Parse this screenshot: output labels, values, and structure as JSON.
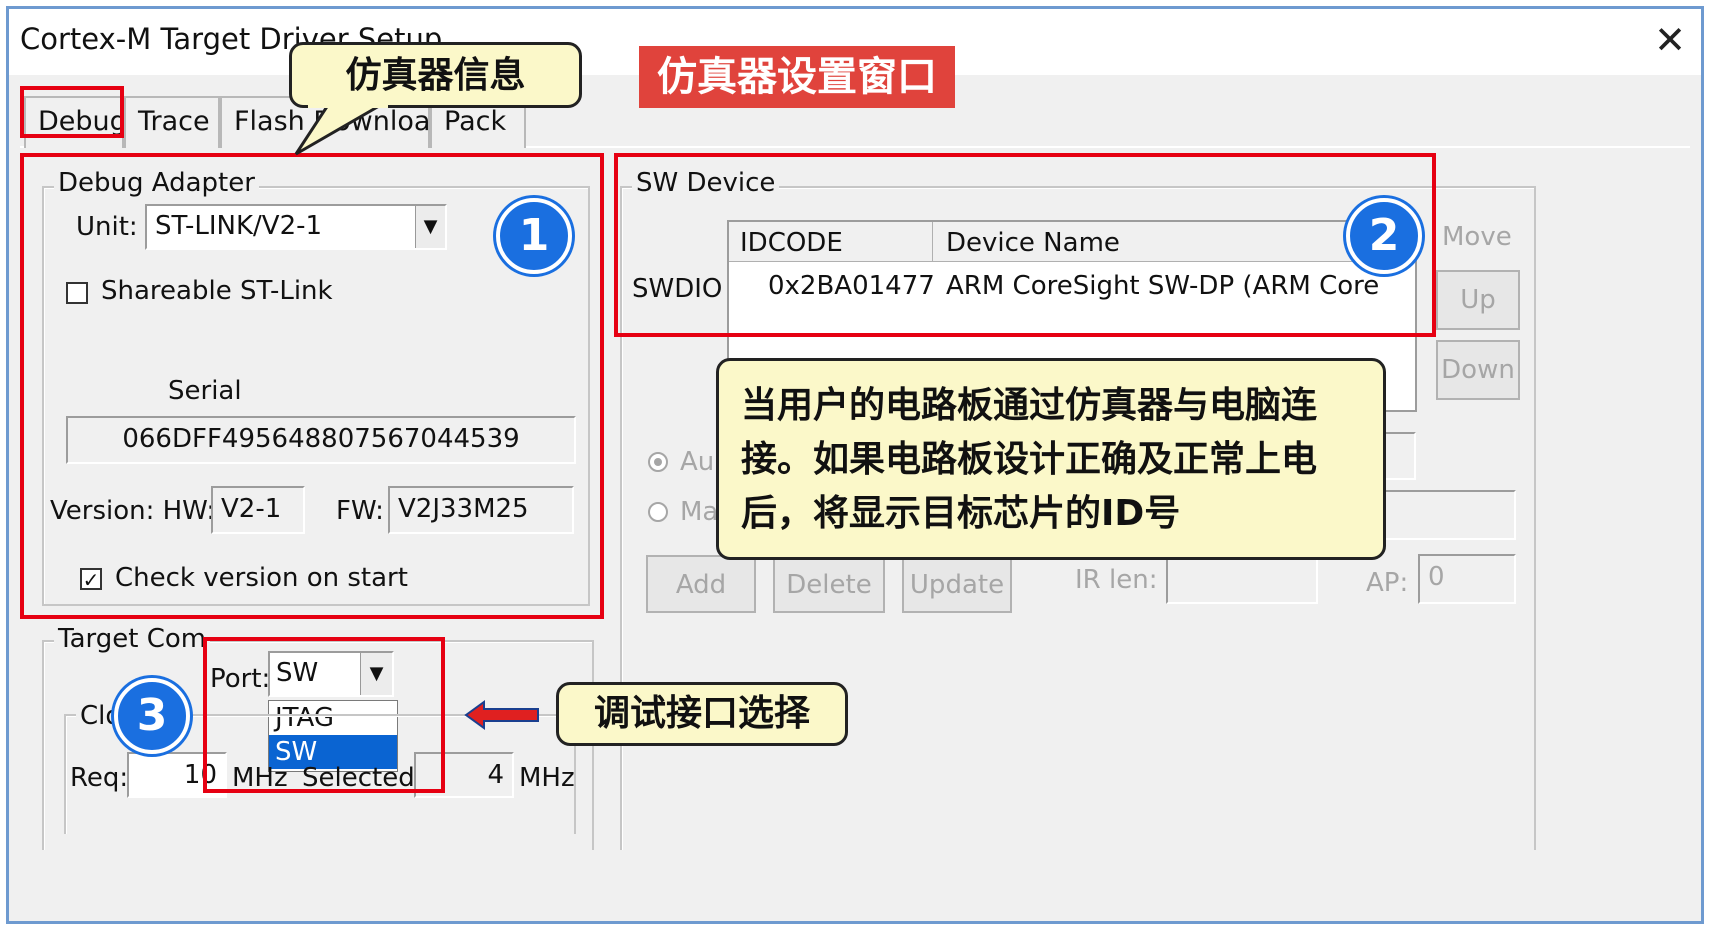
{
  "window": {
    "title": "Cortex-M Target Driver Setup"
  },
  "tabs": [
    {
      "label": "Debug"
    },
    {
      "label": "Trace"
    },
    {
      "label": "Flash Download"
    },
    {
      "label": "Pack"
    }
  ],
  "debug_adapter": {
    "legend": "Debug Adapter",
    "unit_label": "Unit:",
    "unit_value": "ST-LINK/V2-1",
    "shareable_label": "Shareable ST-Link",
    "serial_label": "Serial",
    "serial_value": "066DFF495648807567044539",
    "version_label": "Version: HW:",
    "hw_value": "V2-1",
    "fw_label": "FW:",
    "fw_value": "V2J33M25",
    "check_version_label": "Check version on start",
    "check_mark": "✓"
  },
  "target_com": {
    "legend": "Target Com",
    "port_label": "Port:",
    "port_value": "SW",
    "port_options": [
      "JTAG",
      "SW"
    ],
    "clock_legend": "Clo",
    "req_label": "Req:",
    "req_value": "10",
    "mhz": "MHz",
    "selected_label": "Selected:",
    "selected_value": "4",
    "selected_mhz": "MHz"
  },
  "sw_device": {
    "legend": "SW Device",
    "row_label": "SWDIO",
    "col_idcode": "IDCODE",
    "col_device_name": "Device Name",
    "idcode_value": "0x2BA01477",
    "device_name_value": "ARM CoreSight SW-DP (ARM Core",
    "move_label": "Move",
    "up_label": "Up",
    "down_label": "Down",
    "radio_auto": "Au",
    "radio_manual": "Ma",
    "add_label": "Add",
    "delete_label": "Delete",
    "update_label": "Update",
    "ir_len_label": "IR len:",
    "ap_label": "AP:",
    "ap_value": "0"
  },
  "annotations": {
    "banner": "仿真器设置窗口",
    "callout_info": "仿真器信息",
    "callout_id": "当用户的电路板通过仿真器与电脑连接。如果电路板设计正确及正常上电后，将显示目标芯片的ID号",
    "callout_port": "调试接口选择",
    "badge_1": "1",
    "badge_2": "2",
    "badge_3": "3"
  },
  "colors": {
    "annotation_red": "#e60012",
    "badge_blue": "#1a6fe0",
    "callout_fill": "#fbf8c9",
    "banner_red": "#e0433c",
    "selected_blue": "#0a64d2"
  }
}
